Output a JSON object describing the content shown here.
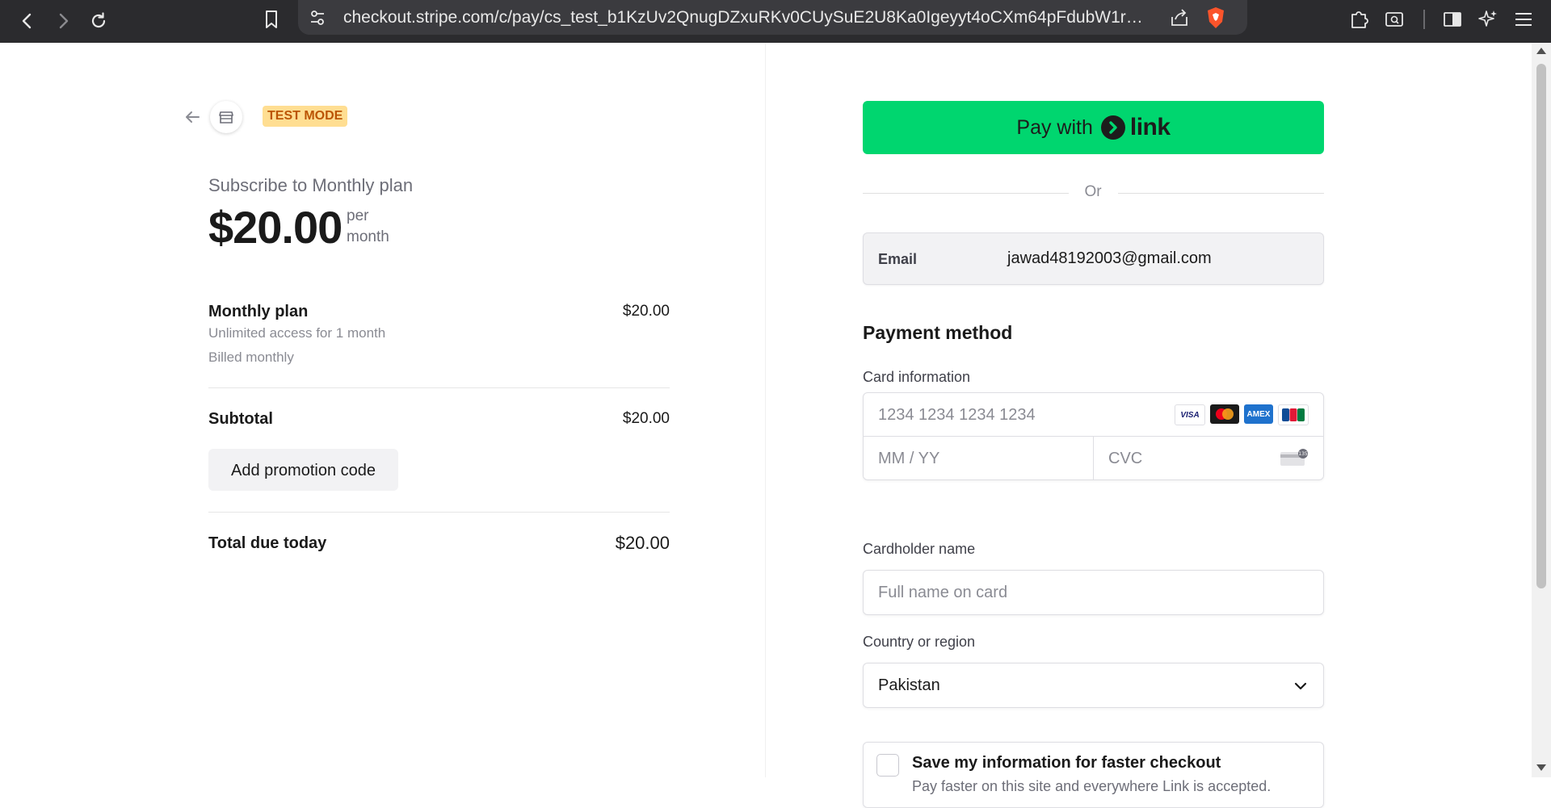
{
  "browser": {
    "url": "checkout.stripe.com/c/pay/cs_test_b1KzUv2QnugDZxuRKv0CUySuE2U8Ka0Igeyyt4oCXm64pFdubW1rF1TJ..."
  },
  "summary": {
    "badge": "TEST MODE",
    "subscribe_title": "Subscribe to Monthly plan",
    "price": "$20.00",
    "period": "per month",
    "line_item": {
      "name": "Monthly plan",
      "price": "$20.00",
      "description": "Unlimited access for 1 month",
      "billing": "Billed monthly"
    },
    "subtotal_label": "Subtotal",
    "subtotal_value": "$20.00",
    "promo_button": "Add promotion code",
    "total_label": "Total due today",
    "total_value": "$20.00"
  },
  "form": {
    "link_button_prefix": "Pay with",
    "link_button_word": "link",
    "or_text": "Or",
    "email_label": "Email",
    "email_value": "jawad48192003@gmail.com",
    "payment_method_title": "Payment method",
    "card_info_label": "Card information",
    "card_number_placeholder": "1234 1234 1234 1234",
    "expiry_placeholder": "MM / YY",
    "cvc_placeholder": "CVC",
    "card_brands": [
      "VISA",
      "mastercard",
      "AMEX",
      "JCB"
    ],
    "cardholder_label": "Cardholder name",
    "cardholder_placeholder": "Full name on card",
    "country_label": "Country or region",
    "country_value": "Pakistan",
    "save_title": "Save my information for faster checkout",
    "save_desc": "Pay faster on this site and everywhere Link is accepted."
  },
  "colors": {
    "link_green": "#00d66f",
    "test_badge_bg": "#ffde92",
    "test_badge_text": "#bb5504",
    "chrome_bg": "#2b2b2e"
  }
}
